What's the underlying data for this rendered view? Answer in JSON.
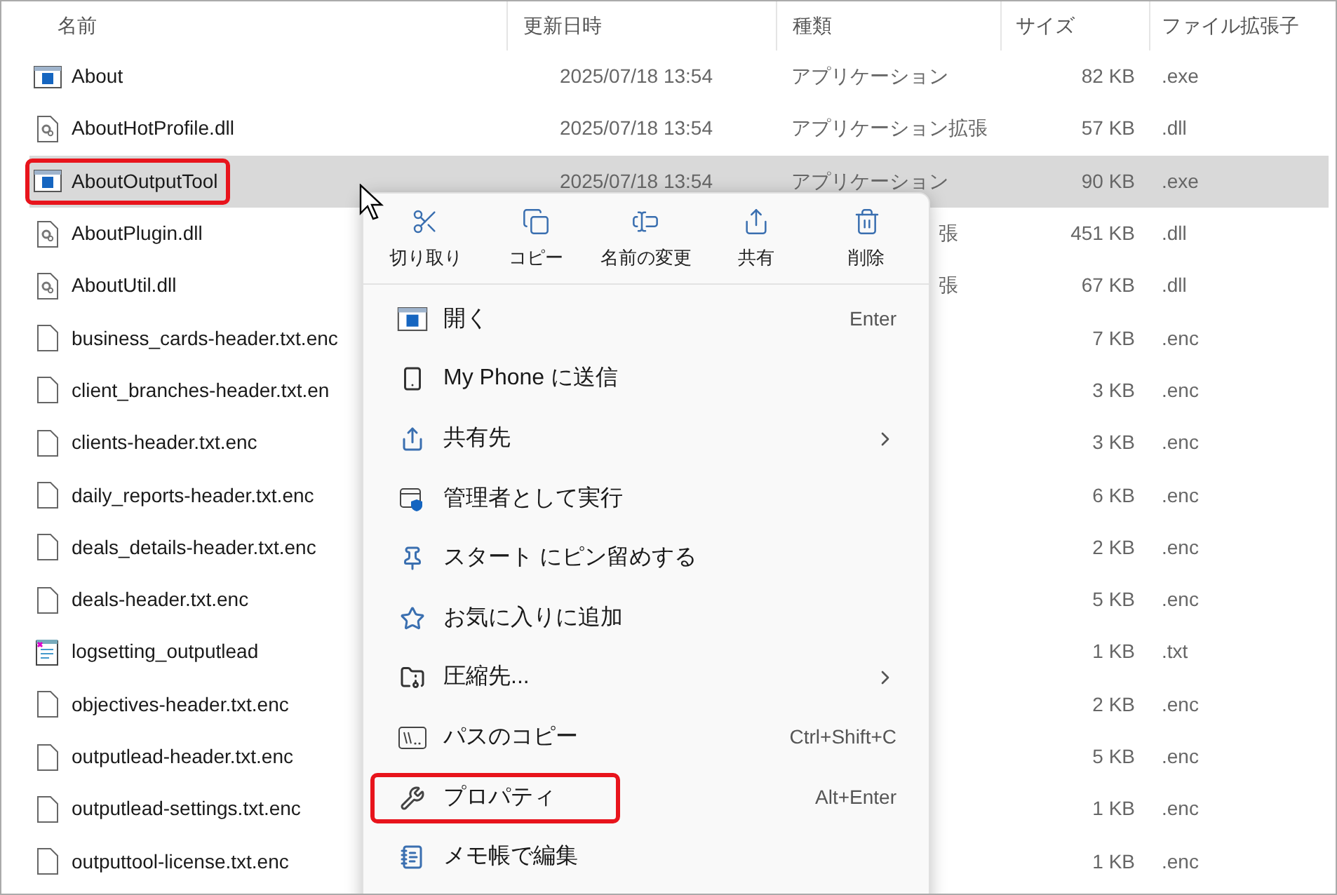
{
  "table": {
    "columns": [
      "名前",
      "更新日時",
      "種類",
      "サイズ",
      "ファイル拡張子"
    ],
    "rows": [
      {
        "kind": "app",
        "name": "About",
        "date": "2025/07/18 13:54",
        "type": "アプリケーション",
        "size": "82 KB",
        "ext": ".exe",
        "selected": false,
        "highlighted": false
      },
      {
        "kind": "dll",
        "name": "AboutHotProfile.dll",
        "date": "2025/07/18 13:54",
        "type": "アプリケーション拡張",
        "size": "57 KB",
        "ext": ".dll",
        "selected": false,
        "highlighted": false
      },
      {
        "kind": "app",
        "name": "AboutOutputTool",
        "date": "2025/07/18 13:54",
        "type": "アプリケーション",
        "size": "90 KB",
        "ext": ".exe",
        "selected": true,
        "highlighted": true
      },
      {
        "kind": "dll",
        "name": "AboutPlugin.dll",
        "type_tail": "張",
        "size": "451 KB",
        "ext": ".dll",
        "selected": false,
        "highlighted": false
      },
      {
        "kind": "dll",
        "name": "AboutUtil.dll",
        "type_tail": "張",
        "size": "67 KB",
        "ext": ".dll",
        "selected": false,
        "highlighted": false
      },
      {
        "kind": "file",
        "name": "business_cards-header.txt.enc",
        "size": "7 KB",
        "ext": ".enc",
        "selected": false,
        "highlighted": false
      },
      {
        "kind": "file",
        "name": "client_branches-header.txt.en",
        "size": "3 KB",
        "ext": ".enc",
        "selected": false,
        "highlighted": false
      },
      {
        "kind": "file",
        "name": "clients-header.txt.enc",
        "size": "3 KB",
        "ext": ".enc",
        "selected": false,
        "highlighted": false
      },
      {
        "kind": "file",
        "name": "daily_reports-header.txt.enc",
        "size": "6 KB",
        "ext": ".enc",
        "selected": false,
        "highlighted": false
      },
      {
        "kind": "file",
        "name": "deals_details-header.txt.enc",
        "size": "2 KB",
        "ext": ".enc",
        "selected": false,
        "highlighted": false
      },
      {
        "kind": "file",
        "name": "deals-header.txt.enc",
        "size": "5 KB",
        "ext": ".enc",
        "selected": false,
        "highlighted": false
      },
      {
        "kind": "text",
        "name": "logsetting_outputlead",
        "size": "1 KB",
        "ext": ".txt",
        "selected": false,
        "highlighted": false
      },
      {
        "kind": "file",
        "name": "objectives-header.txt.enc",
        "size": "2 KB",
        "ext": ".enc",
        "selected": false,
        "highlighted": false
      },
      {
        "kind": "file",
        "name": "outputlead-header.txt.enc",
        "size": "5 KB",
        "ext": ".enc",
        "selected": false,
        "highlighted": false
      },
      {
        "kind": "file",
        "name": "outputlead-settings.txt.enc",
        "size": "1 KB",
        "ext": ".enc",
        "selected": false,
        "highlighted": false
      },
      {
        "kind": "file",
        "name": "outputtool-license.txt.enc",
        "size": "1 KB",
        "ext": ".enc",
        "selected": false,
        "highlighted": false
      }
    ]
  },
  "context_menu": {
    "actions": [
      {
        "label": "切り取り"
      },
      {
        "label": "コピー"
      },
      {
        "label": "名前の変更"
      },
      {
        "label": "共有"
      },
      {
        "label": "削除"
      }
    ],
    "items": [
      {
        "label": "開く",
        "shortcut": "Enter",
        "submenu": false,
        "highlighted": false
      },
      {
        "label": "My Phone に送信",
        "submenu": false,
        "highlighted": false
      },
      {
        "label": "共有先",
        "submenu": true,
        "highlighted": false
      },
      {
        "label": "管理者として実行",
        "submenu": false,
        "highlighted": false
      },
      {
        "label": "スタート にピン留めする",
        "submenu": false,
        "highlighted": false
      },
      {
        "label": "お気に入りに追加",
        "submenu": false,
        "highlighted": false
      },
      {
        "label": "圧縮先...",
        "submenu": true,
        "highlighted": false
      },
      {
        "label": "パスのコピー",
        "shortcut": "Ctrl+Shift+C",
        "submenu": false,
        "highlighted": false
      },
      {
        "label": "プロパティ",
        "shortcut": "Alt+Enter",
        "submenu": false,
        "highlighted": true
      },
      {
        "label": "メモ帳で編集",
        "submenu": false,
        "highlighted": false
      }
    ]
  }
}
